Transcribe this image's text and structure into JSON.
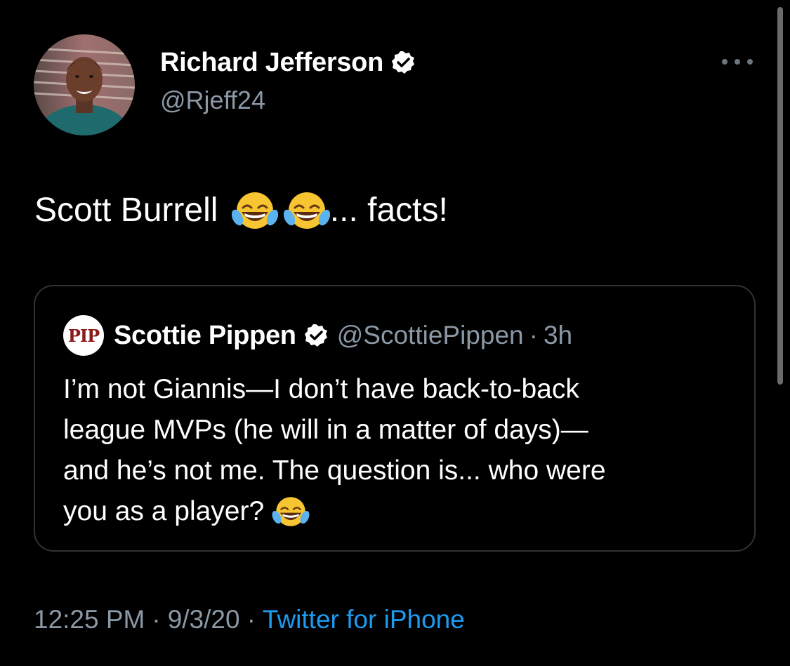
{
  "tweet": {
    "author": {
      "name": "Richard Jefferson",
      "handle": "@Rjeff24",
      "verified": true,
      "avatar": "avatar-photo"
    },
    "text_before_emoji": "Scott Burrell ",
    "emoji": [
      "face-with-tears-of-joy",
      "face-with-tears-of-joy"
    ],
    "text_after_emoji": "... facts!",
    "more_icon": "more-horizontal-icon",
    "quoted": {
      "author_name": "Scottie Pippen",
      "avatar_text": "PIP",
      "verified": true,
      "handle": "@ScottiePippen",
      "separator": "·",
      "time": "3h",
      "lines": [
        "I’m not Giannis—I don’t have back-to-back",
        "league MVPs (he will in a matter of days)—",
        "and he’s not me. The question is... who were",
        "you as a player? "
      ],
      "trailing_emoji": "face-with-tears-of-joy"
    },
    "meta": {
      "time": "12:25 PM",
      "separator": "·",
      "date": "9/3/20",
      "source": "Twitter for iPhone"
    }
  },
  "colors": {
    "background": "#000000",
    "text_primary": "#ffffff",
    "text_secondary": "#8b98a5",
    "accent": "#1d9bf0",
    "border": "#2f3336"
  }
}
